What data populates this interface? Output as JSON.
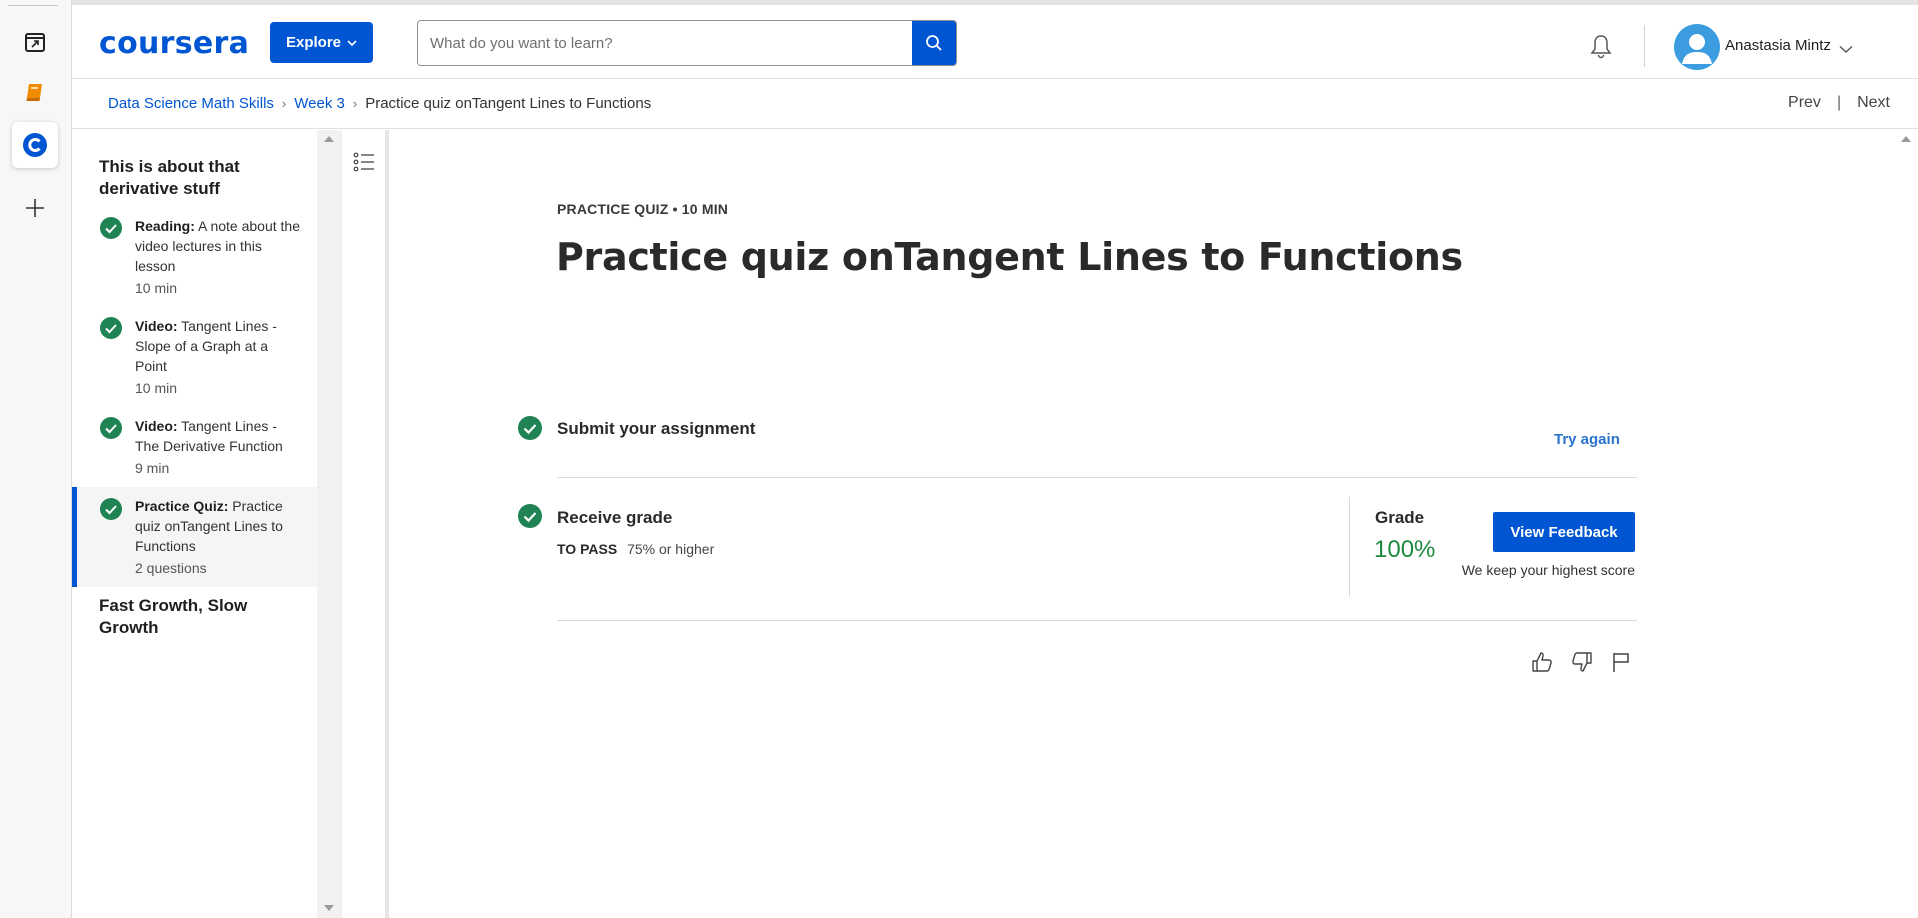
{
  "rail": {
    "items": [
      {
        "icon": "calendar-icon"
      },
      {
        "icon": "book-icon"
      },
      {
        "icon": "coursera-app-icon"
      },
      {
        "icon": "plus-icon"
      }
    ]
  },
  "header": {
    "logo": "coursera",
    "explore_label": "Explore",
    "search_placeholder": "What do you want to learn?",
    "user_name": "Anastasia Mintz",
    "brand_color": "#0056d2"
  },
  "breadcrumb": {
    "items": [
      "Data Science Math Skills",
      "Week 3"
    ],
    "current": "Practice quiz onTangent Lines to Functions",
    "prev_label": "Prev",
    "next_label": "Next"
  },
  "sidebar": {
    "section_title": "This is about that derivative stuff",
    "items": [
      {
        "type": "Reading:",
        "title": "A note about the video lectures in this lesson",
        "meta": "10 min",
        "done": true
      },
      {
        "type": "Video:",
        "title": "Tangent Lines - Slope of a Graph at a Point",
        "meta": "10 min",
        "done": true
      },
      {
        "type": "Video:",
        "title": "Tangent Lines - The Derivative Function",
        "meta": "9 min",
        "done": true
      },
      {
        "type": "Practice Quiz:",
        "title": "Practice quiz onTangent Lines to Functions",
        "meta": "2 questions",
        "done": true,
        "active": true
      }
    ],
    "next_section_title": "Fast Growth, Slow Growth"
  },
  "main": {
    "quiz_meta": "PRACTICE QUIZ • 10 MIN",
    "title": "Practice quiz onTangent Lines to Functions",
    "submit_title": "Submit your assignment",
    "try_again_label": "Try again",
    "receive_title": "Receive grade",
    "to_pass_label": "TO PASS",
    "to_pass_value": "75% or higher",
    "grade_label": "Grade",
    "grade_value": "100%",
    "view_feedback_label": "View Feedback",
    "keep_note": "We keep your highest score",
    "success_color": "#1f8354"
  }
}
